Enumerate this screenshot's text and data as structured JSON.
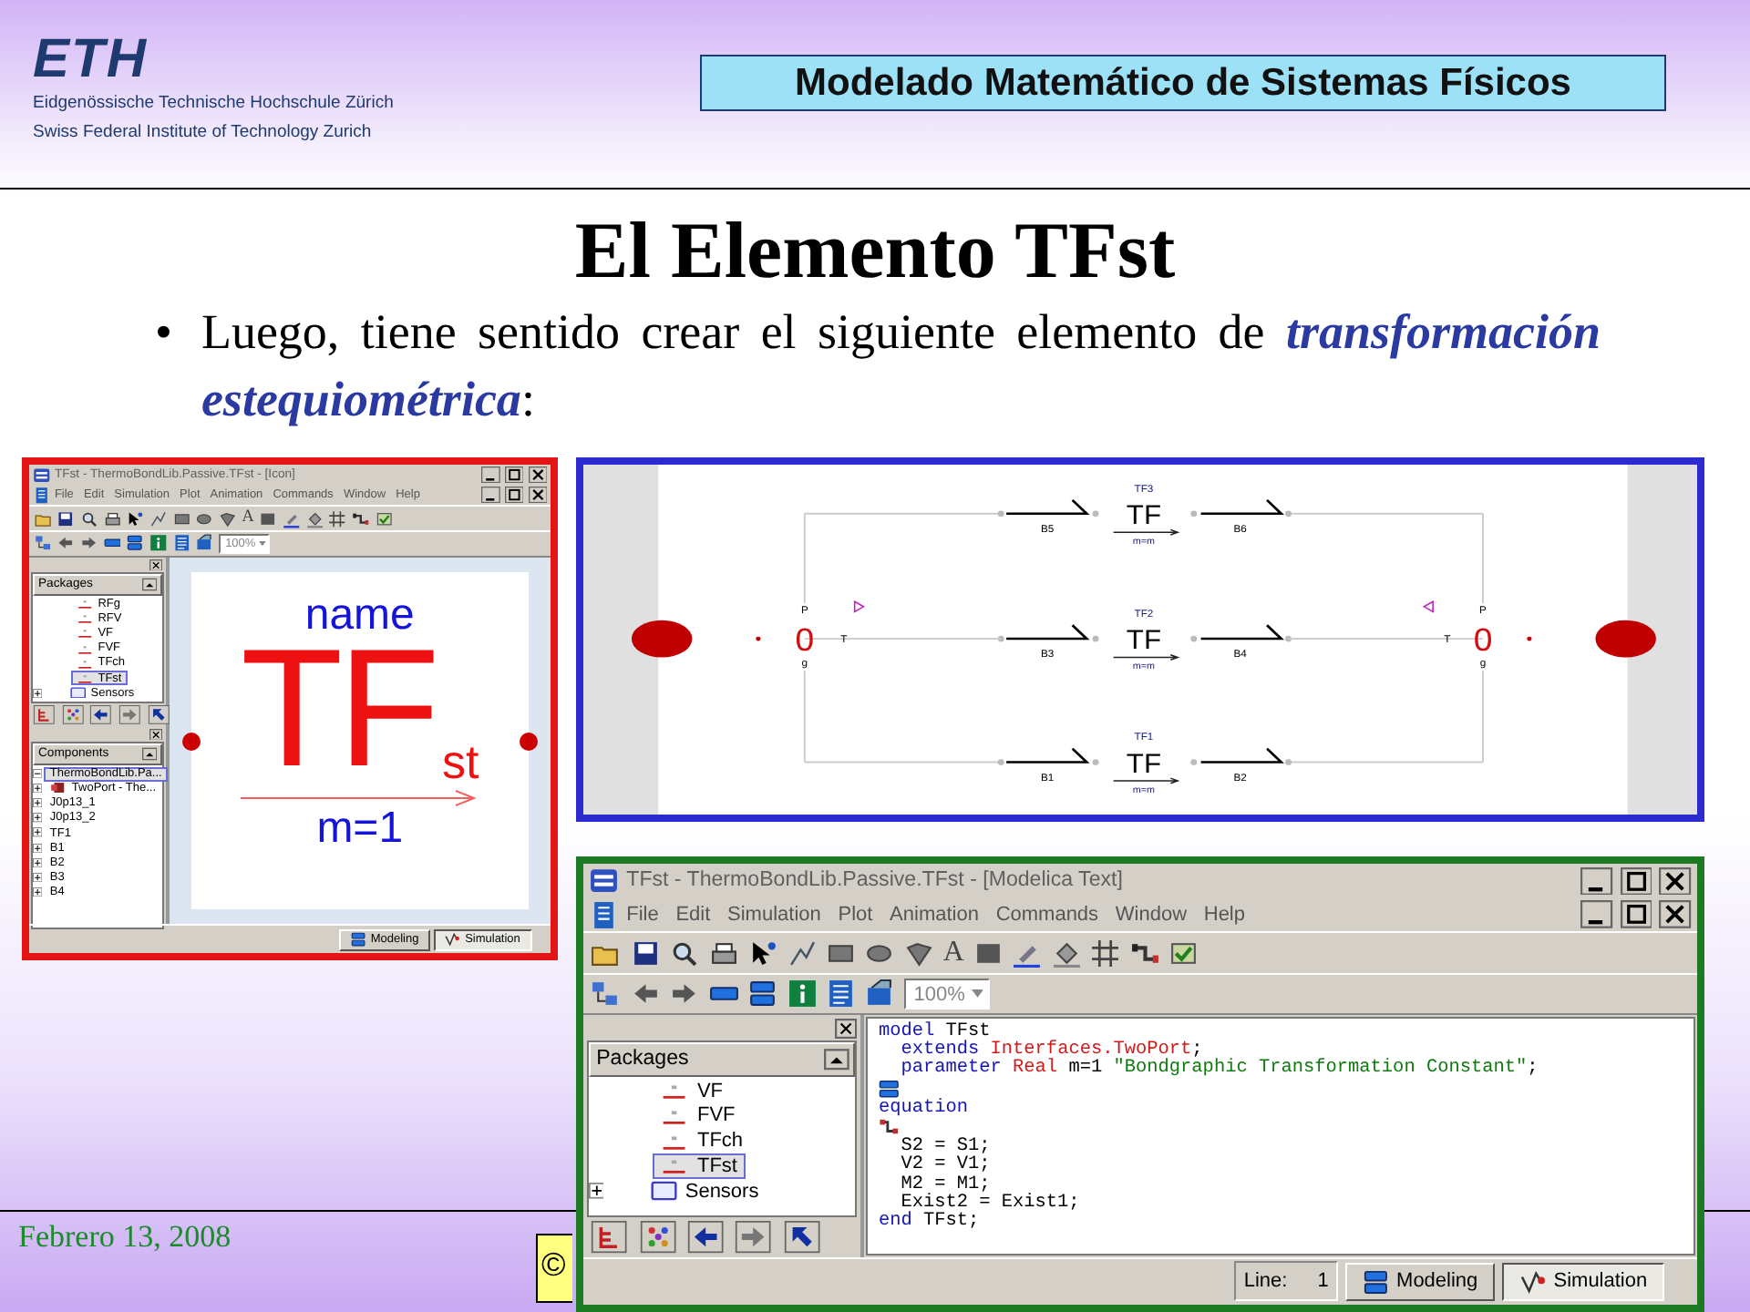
{
  "header": {
    "logo": "ETH",
    "institution_lines": [
      "Eidgenössische Technische Hochschule Zürich",
      "Swiss Federal Institute of Technology Zurich"
    ],
    "course_title": "Modelado Matemático de Sistemas Físicos"
  },
  "slide_title": "El Elemento TFst",
  "bullets": [
    {
      "marker": "•",
      "text": "Luego, tiene sentido crear el siguiente elemento de *transformación estequiométrica*:"
    }
  ],
  "icon_window": {
    "title": "TFst - ThermoBondLib.Passive.TFst - [Icon]",
    "menu": [
      "File",
      "Edit",
      "Simulation",
      "Plot",
      "Animation",
      "Commands",
      "Window",
      "Help"
    ],
    "text_tool": "A",
    "zoom": "100%",
    "packages": {
      "header": "Packages",
      "items": [
        {
          "label": "RFg",
          "kind": "model",
          "selected": false
        },
        {
          "label": "RFV",
          "kind": "model",
          "selected": false
        },
        {
          "label": "VF",
          "kind": "model",
          "selected": false
        },
        {
          "label": "FVF",
          "kind": "model",
          "selected": false
        },
        {
          "label": "TFch",
          "kind": "model",
          "selected": false
        },
        {
          "label": "TFst",
          "kind": "model",
          "selected": true
        },
        {
          "label": "Sensors",
          "kind": "package",
          "selected": false
        }
      ]
    },
    "components": {
      "header": "Components",
      "items": [
        {
          "label": "ThermoBondLib.Pa...",
          "kind": "root",
          "selected": true
        },
        {
          "label": "TwoPort - The...",
          "kind": "class",
          "selected": false
        },
        {
          "label": "J0p13_1",
          "kind": "component",
          "selected": false
        },
        {
          "label": "J0p13_2",
          "kind": "component",
          "selected": false
        },
        {
          "label": "TF1",
          "kind": "component",
          "selected": false
        },
        {
          "label": "B1",
          "kind": "component",
          "selected": false
        },
        {
          "label": "B2",
          "kind": "component",
          "selected": false
        },
        {
          "label": "B3",
          "kind": "component",
          "selected": false
        },
        {
          "label": "B4",
          "kind": "component",
          "selected": false
        }
      ]
    },
    "canvas": {
      "name_label": "name",
      "symbol": "TF",
      "subscript": "st",
      "parameter": "m=1"
    },
    "mode_buttons": [
      {
        "label": "Modeling",
        "selected": false
      },
      {
        "label": "Simulation",
        "selected": true
      }
    ]
  },
  "diagram": {
    "transformers": [
      {
        "label": "TF3",
        "symbol": "TF",
        "parameter": "m=m",
        "bond_in": "B5",
        "bond_out": "B6"
      },
      {
        "label": "TF2",
        "symbol": "TF",
        "parameter": "m=m",
        "bond_in": "B3",
        "bond_out": "B4"
      },
      {
        "label": "TF1",
        "symbol": "TF",
        "parameter": "m=m",
        "bond_in": "B1",
        "bond_out": "B2"
      }
    ],
    "junctions": [
      {
        "symbol": "0",
        "top_port": "P",
        "side_port": "T",
        "bottom_port": "g"
      },
      {
        "symbol": "0",
        "top_port": "P",
        "side_port": "T",
        "bottom_port": "g"
      }
    ]
  },
  "text_window": {
    "title": "TFst - ThermoBondLib.Passive.TFst - [Modelica Text]",
    "menu": [
      "File",
      "Edit",
      "Simulation",
      "Plot",
      "Animation",
      "Commands",
      "Window",
      "Help"
    ],
    "text_tool": "A",
    "zoom": "100%",
    "packages": {
      "header": "Packages",
      "items": [
        {
          "label": "VF",
          "kind": "model",
          "selected": false
        },
        {
          "label": "FVF",
          "kind": "model",
          "selected": false
        },
        {
          "label": "TFch",
          "kind": "model",
          "selected": false
        },
        {
          "label": "TFst",
          "kind": "model",
          "selected": true
        },
        {
          "label": "Sensors",
          "kind": "package",
          "selected": false
        }
      ]
    },
    "code_lines": [
      {
        "kind": "code",
        "tokens": [
          {
            "text": "model",
            "kind": "keyword"
          },
          {
            "text": " TFst",
            "kind": "plain"
          }
        ]
      },
      {
        "kind": "code",
        "tokens": [
          {
            "text": "  extends",
            "kind": "keyword"
          },
          {
            "text": " Interfaces.TwoPort",
            "kind": "type"
          },
          {
            "text": ";",
            "kind": "plain"
          }
        ]
      },
      {
        "kind": "code",
        "tokens": [
          {
            "text": "  parameter",
            "kind": "keyword"
          },
          {
            "text": " Real",
            "kind": "type"
          },
          {
            "text": " m=1 ",
            "kind": "plain"
          },
          {
            "text": "\"Bondgraphic Transformation Constant\"",
            "kind": "string"
          },
          {
            "text": ";",
            "kind": "plain"
          }
        ]
      },
      {
        "kind": "annotation"
      },
      {
        "kind": "code",
        "tokens": [
          {
            "text": "equation",
            "kind": "keyword"
          }
        ]
      },
      {
        "kind": "graphics"
      },
      {
        "kind": "code",
        "tokens": [
          {
            "text": "  S2 = S1;",
            "kind": "plain"
          }
        ]
      },
      {
        "kind": "code",
        "tokens": [
          {
            "text": "  V2 = V1;",
            "kind": "plain"
          }
        ]
      },
      {
        "kind": "code",
        "tokens": [
          {
            "text": "  M2 = M1;",
            "kind": "plain"
          }
        ]
      },
      {
        "kind": "code",
        "tokens": [
          {
            "text": "  Exist2 = Exist1;",
            "kind": "plain"
          }
        ]
      },
      {
        "kind": "code",
        "tokens": [
          {
            "text": "end",
            "kind": "keyword"
          },
          {
            "text": " TFst;",
            "kind": "plain"
          }
        ]
      }
    ],
    "status": {
      "line_label": "Line:",
      "line_value": "1"
    },
    "mode_buttons": [
      {
        "label": "Modeling",
        "selected": false
      },
      {
        "label": "Simulation",
        "selected": true
      }
    ]
  },
  "footer": {
    "date": "Febrero 13, 2008",
    "badge": "©"
  }
}
